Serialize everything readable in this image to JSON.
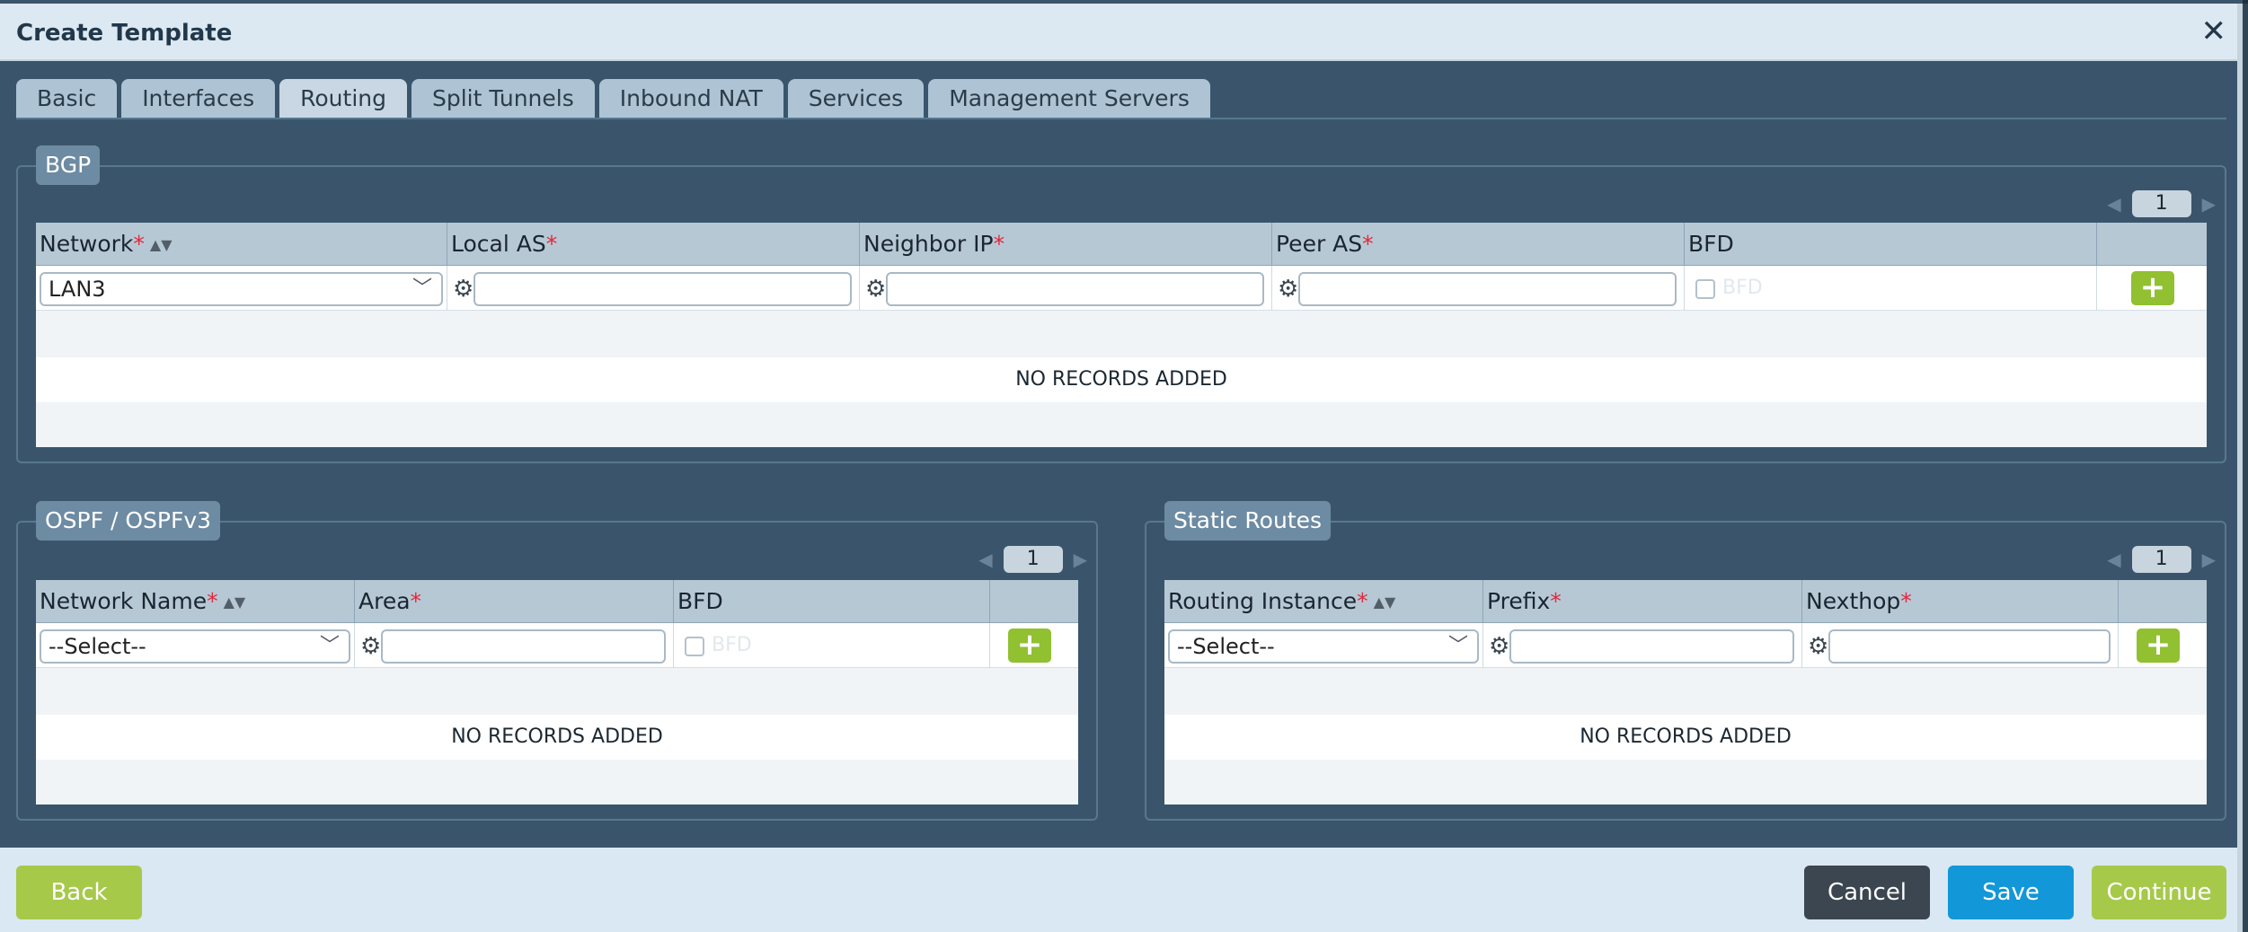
{
  "dialog": {
    "title": "Create Template",
    "close_label": "✕"
  },
  "tabs": [
    {
      "label": "Basic"
    },
    {
      "label": "Interfaces"
    },
    {
      "label": "Routing",
      "active": true
    },
    {
      "label": "Split Tunnels"
    },
    {
      "label": "Inbound NAT"
    },
    {
      "label": "Services"
    },
    {
      "label": "Management Servers"
    }
  ],
  "pager_prev": "◀",
  "pager_next": "▶",
  "bgp": {
    "legend": "BGP",
    "page": "1",
    "columns": {
      "network": "Network",
      "local_as": "Local AS",
      "neighbor_ip": "Neighbor IP",
      "peer_as": "Peer AS",
      "bfd": "BFD"
    },
    "entry": {
      "network_value": "LAN3",
      "bfd_label": "BFD"
    },
    "no_records": "NO RECORDS ADDED"
  },
  "ospf": {
    "legend": "OSPF / OSPFv3",
    "page": "1",
    "columns": {
      "network_name": "Network Name",
      "area": "Area",
      "bfd": "BFD"
    },
    "entry": {
      "network_value": "--Select--",
      "bfd_label": "BFD"
    },
    "no_records": "NO RECORDS ADDED"
  },
  "static_routes": {
    "legend": "Static Routes",
    "page": "1",
    "columns": {
      "routing_instance": "Routing Instance",
      "prefix": "Prefix",
      "nexthop": "Nexthop"
    },
    "entry": {
      "routing_instance_value": "--Select--"
    },
    "no_records": "NO RECORDS ADDED"
  },
  "symbols": {
    "required": "*",
    "sort": "▲▼",
    "chevron": "﹀",
    "gear": "⚙",
    "add": "+"
  },
  "footer": {
    "back": "Back",
    "cancel": "Cancel",
    "save": "Save",
    "continue": "Continue"
  },
  "colors": {
    "accent_green": "#91c031",
    "save_blue": "#1297d8",
    "required_red": "#e0293d",
    "panel_bg": "#3a556b"
  }
}
